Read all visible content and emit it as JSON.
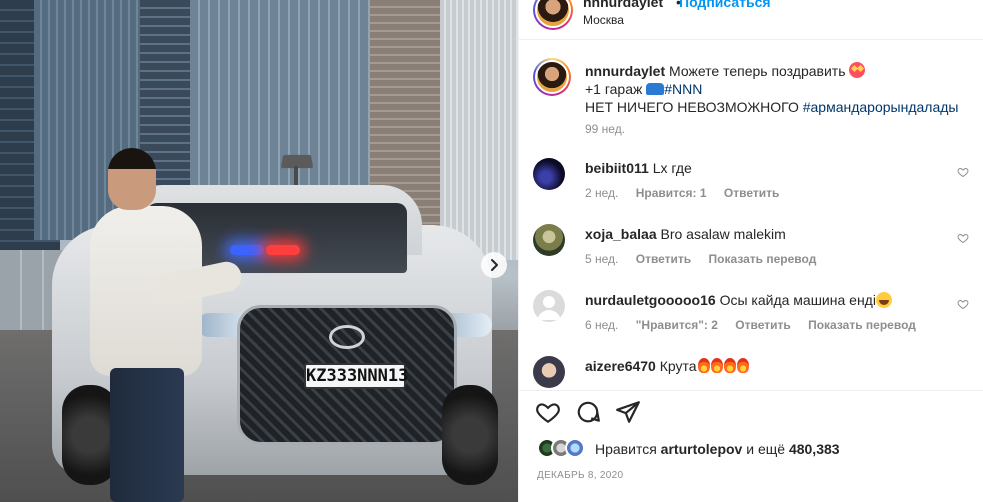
{
  "post": {
    "photo": {
      "plate": "KZ333NNN13",
      "next_icon": "chevron-right-icon"
    }
  },
  "header": {
    "username": "nnnurdaylet",
    "dot": "•",
    "follow_label": "Подписаться",
    "location": "Москва"
  },
  "caption": {
    "username": "nnnurdaylet",
    "line1": "Можете теперь поздравить",
    "line2_prefix": "+1 гараж",
    "line2_tag": "#NNN",
    "line3_text": "НЕТ НИЧЕГО НЕВОЗМОЖНОГО",
    "line3_tag": "#армандарорындалады",
    "time": "99 нед."
  },
  "comments": [
    {
      "username": "beibiit011",
      "text": "Lx где",
      "time": "2 нед.",
      "likes": "Нравится: 1",
      "reply": "Ответить",
      "translate": ""
    },
    {
      "username": "xoja_balaa",
      "text": "Bro asalaw malekim",
      "time": "5 нед.",
      "likes": "",
      "reply": "Ответить",
      "translate": "Показать перевод"
    },
    {
      "username": "nurdauletgooooo16",
      "text": "Осы кайда машина енді",
      "time": "6 нед.",
      "likes": "\"Нравится\": 2",
      "reply": "Ответить",
      "translate": "Показать перевод"
    },
    {
      "username": "aizere6470",
      "text": "Крута",
      "time": "",
      "likes": "",
      "reply": "",
      "translate": ""
    }
  ],
  "actions": {
    "like_icon": "heart-icon",
    "comment_icon": "comment-icon",
    "share_icon": "paper-plane-icon"
  },
  "likes": {
    "prefix": "Нравится",
    "user": "arturtolepov",
    "mid": "и ещё",
    "count": "480,383"
  },
  "date": "ДЕКАБРЬ 8, 2020",
  "colors": {
    "link": "#0095f6",
    "hashtag": "#00376b",
    "muted": "#8e8e8e",
    "text": "#262626"
  }
}
